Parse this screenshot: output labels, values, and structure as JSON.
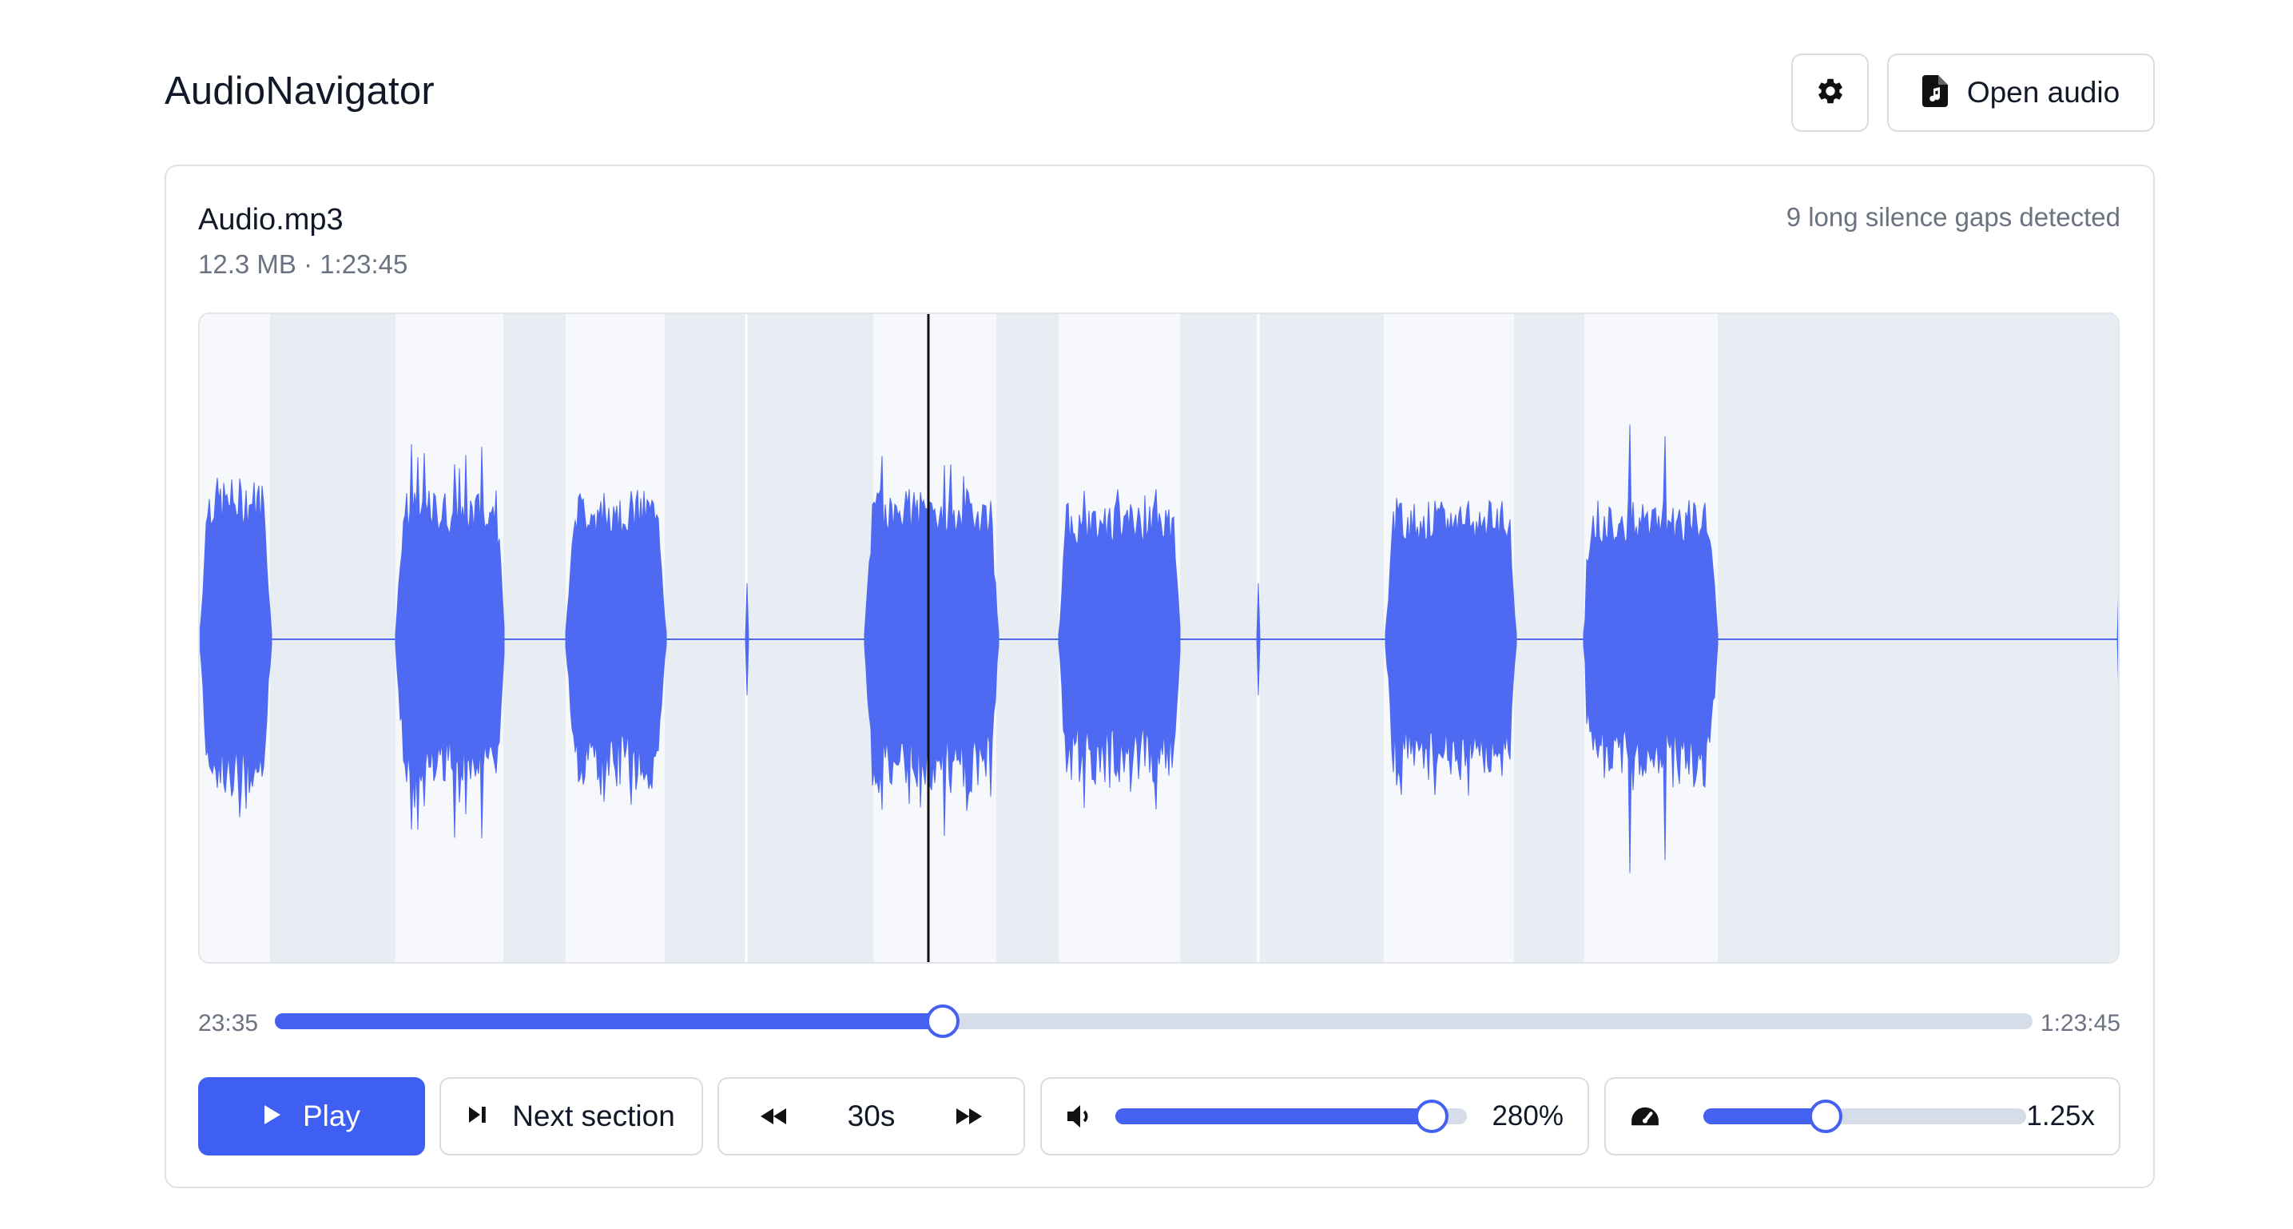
{
  "app": {
    "title": "AudioNavigator"
  },
  "header": {
    "settings_icon": "gear-icon",
    "open_audio_label": "Open audio",
    "open_audio_icon": "audio-file-icon"
  },
  "file": {
    "name": "Audio.mp3",
    "meta": "12.3 MB · 1:23:45",
    "silence_info": "9 long silence gaps detected"
  },
  "waveform": {
    "waveform_color": "#4f6af2",
    "silence_shade_color": "#e8ecf3",
    "sound_shade_color": "#f7f8fb",
    "playhead_color": "#111111"
  },
  "seek": {
    "current_time": "23:35",
    "total_time": "1:23:45",
    "progress": 0.38
  },
  "controls": {
    "play_label": "Play",
    "play_icon": "play-icon",
    "next_section_label": "Next section",
    "next_section_icon": "skip-next-icon",
    "skip_back_icon": "rewind-icon",
    "skip_interval": "30s",
    "skip_forward_icon": "fast-forward-icon",
    "volume_icon": "volume-icon",
    "volume_value": "280%",
    "volume_level": 0.9,
    "speed_icon": "speedometer-icon",
    "speed_value": "1.25x",
    "speed_level": 0.38
  },
  "colors": {
    "accent": "#3f5ff2",
    "track": "#d6dde8",
    "muted_text": "#6b7280"
  }
}
